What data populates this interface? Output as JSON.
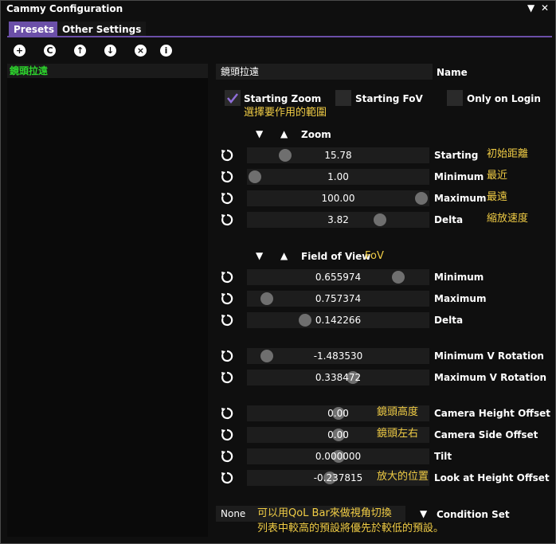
{
  "window": {
    "title": "Cammy Configuration"
  },
  "tabs": [
    {
      "label": "Presets"
    },
    {
      "label": "Other Settings"
    }
  ],
  "toolbar": {
    "icons": [
      "plus-icon",
      "copy-icon",
      "arrow-up-icon",
      "arrow-down-icon",
      "delete-icon",
      "info-icon"
    ]
  },
  "presets": {
    "selected": "鏡頭拉遠"
  },
  "name_field": {
    "value": "鏡頭拉遠",
    "label": "Name"
  },
  "checks": {
    "starting_zoom": {
      "label": "Starting Zoom",
      "checked": true
    },
    "starting_fov": {
      "label": "Starting FoV",
      "checked": false
    },
    "only_on_login": {
      "label": "Only on Login",
      "checked": false
    },
    "note": "選擇要作用的範圍"
  },
  "zoom": {
    "header": "Zoom",
    "rows": [
      {
        "value": "15.78",
        "label": "Starting",
        "note": "初始距離",
        "knob": 0.18
      },
      {
        "value": "1.00",
        "label": "Minimum",
        "note": "最近",
        "knob": 0.0
      },
      {
        "value": "100.00",
        "label": "Maximum",
        "note": "最遠",
        "knob": 1.0
      },
      {
        "value": "3.82",
        "label": "Delta",
        "note": "縮放速度",
        "knob": 0.75
      }
    ]
  },
  "fov": {
    "header": "Field of View",
    "header_note": "FoV",
    "rows": [
      {
        "value": "0.655974",
        "label": "Minimum",
        "knob": 0.86
      },
      {
        "value": "0.757374",
        "label": "Maximum",
        "knob": 0.07
      },
      {
        "value": "0.142266",
        "label": "Delta",
        "knob": 0.3
      }
    ]
  },
  "rotation": {
    "rows": [
      {
        "value": "-1.483530",
        "label": "Minimum V Rotation",
        "knob": 0.07
      },
      {
        "value": "0.338472",
        "label": "Maximum V Rotation",
        "knob": 0.59
      }
    ]
  },
  "offsets": {
    "rows": [
      {
        "value": "0.00",
        "label": "Camera Height Offset",
        "note": "鏡頭高度",
        "knob": 0.5
      },
      {
        "value": "0.00",
        "label": "Camera Side Offset",
        "note": "鏡頭左右",
        "knob": 0.5
      },
      {
        "value": "0.000000",
        "label": "Tilt",
        "knob": 0.5
      },
      {
        "value": "-0.237815",
        "label": "Look at Height Offset",
        "note": "放大的位置",
        "knob": 0.45
      }
    ]
  },
  "condition": {
    "value": "None",
    "label": "Condition Set",
    "note_line1": "可以用QoL Bar來做視角切換",
    "note_line2": "列表中較高的預設將優先於較低的預設。"
  }
}
